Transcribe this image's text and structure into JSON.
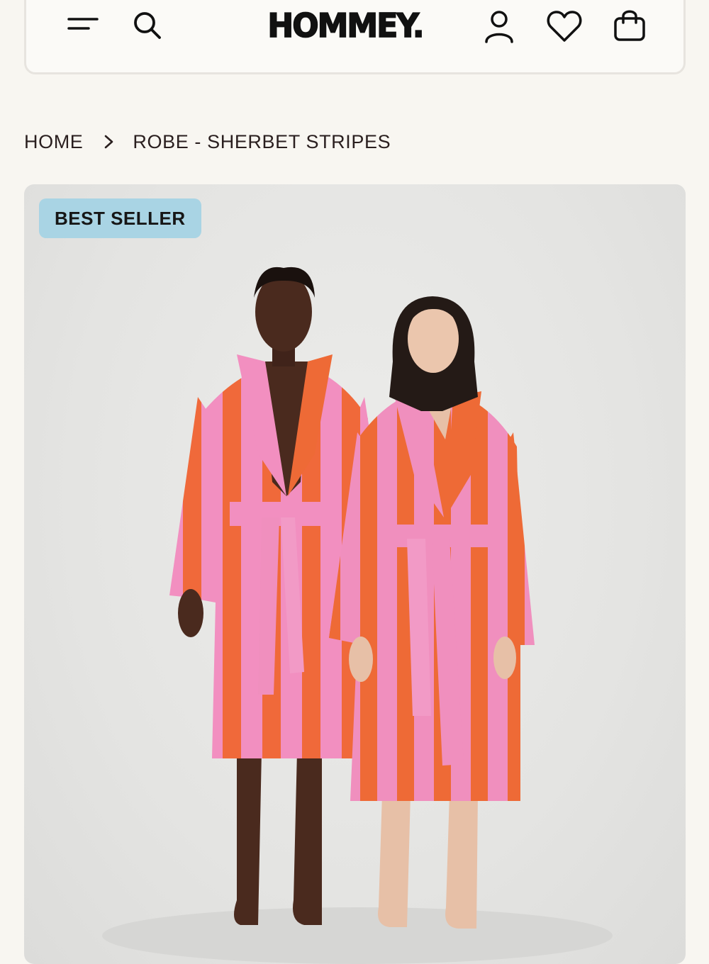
{
  "header": {
    "logo": "HOMMEY.",
    "icons": [
      "menu-icon",
      "search-icon",
      "account-icon",
      "wishlist-icon",
      "cart-icon"
    ]
  },
  "breadcrumb": {
    "home": "HOME",
    "current": "ROBE - SHERBET STRIPES"
  },
  "product": {
    "badge": "BEST SELLER"
  },
  "colors": {
    "background": "#f8f6f1",
    "badge": "#a9d4e4",
    "stripe_pink": "#f08fbf",
    "stripe_orange": "#f06a34"
  }
}
